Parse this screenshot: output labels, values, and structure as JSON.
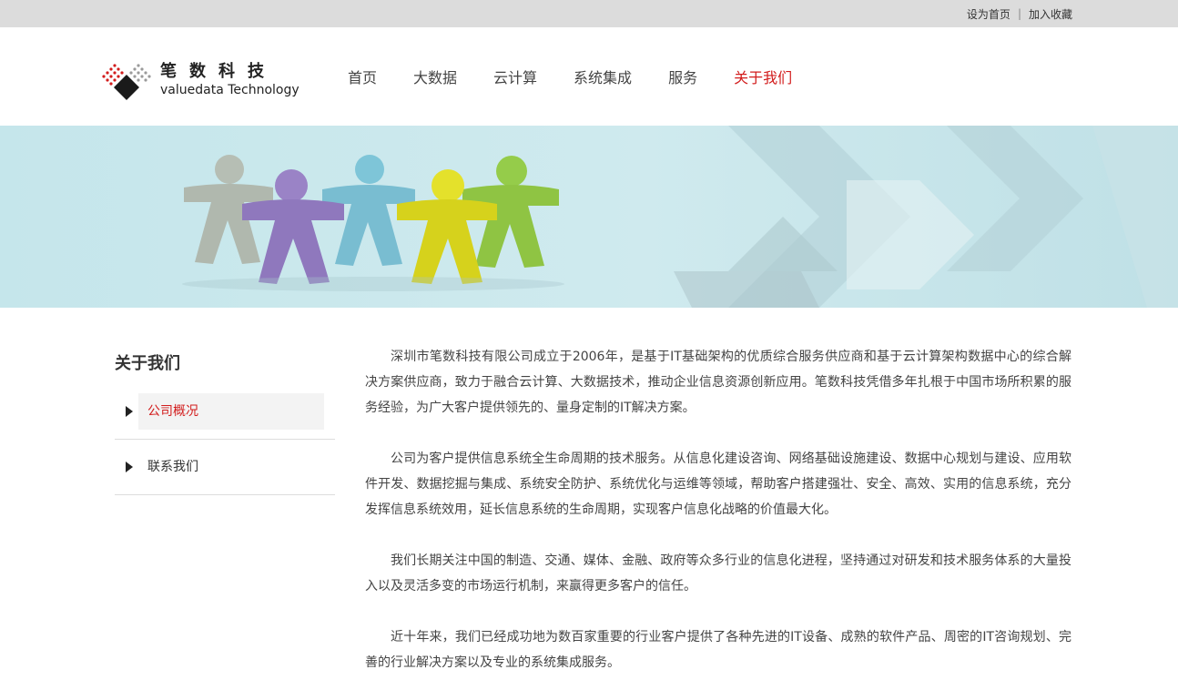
{
  "topbar": {
    "set_home": "设为首页",
    "separator": "|",
    "bookmark": "加入收藏"
  },
  "logo": {
    "cn": "笔数科技",
    "en": "valuedata Technology"
  },
  "nav": {
    "items": [
      {
        "label": "首页",
        "active": false
      },
      {
        "label": "大数据",
        "active": false
      },
      {
        "label": "云计算",
        "active": false
      },
      {
        "label": "系统集成",
        "active": false
      },
      {
        "label": "服务",
        "active": false
      },
      {
        "label": "关于我们",
        "active": true
      }
    ]
  },
  "colors": {
    "accent": "#d21c1c",
    "topbar": "#dcdcdc",
    "banner": "#c3e3e8"
  },
  "sidebar": {
    "title": "关于我们",
    "items": [
      {
        "label": "公司概况",
        "active": true
      },
      {
        "label": "联系我们",
        "active": false
      }
    ]
  },
  "article": {
    "paragraphs": [
      "深圳市笔数科技有限公司成立于2006年，是基于IT基础架构的优质综合服务供应商和基于云计算架构数据中心的综合解决方案供应商，致力于融合云计算、大数据技术，推动企业信息资源创新应用。笔数科技凭借多年扎根于中国市场所积累的服务经验，为广大客户提供领先的、量身定制的IT解决方案。",
      "公司为客户提供信息系统全生命周期的技术服务。从信息化建设咨询、网络基础设施建设、数据中心规划与建设、应用软件开发、数据挖掘与集成、系统安全防护、系统优化与运维等领域，帮助客户搭建强壮、安全、高效、实用的信息系统，充分发挥信息系统效用，延长信息系统的生命周期，实现客户信息化战略的价值最大化。",
      "我们长期关注中国的制造、交通、媒体、金融、政府等众多行业的信息化进程，坚持通过对研发和技术服务体系的大量投入以及灵活多变的市场运行机制，来赢得更多客户的信任。",
      "近十年来，我们已经成功地为数百家重要的行业客户提供了各种先进的IT设备、成熟的软件产品、周密的IT咨询规划、完善的行业解决方案以及专业的系统集成服务。"
    ]
  }
}
